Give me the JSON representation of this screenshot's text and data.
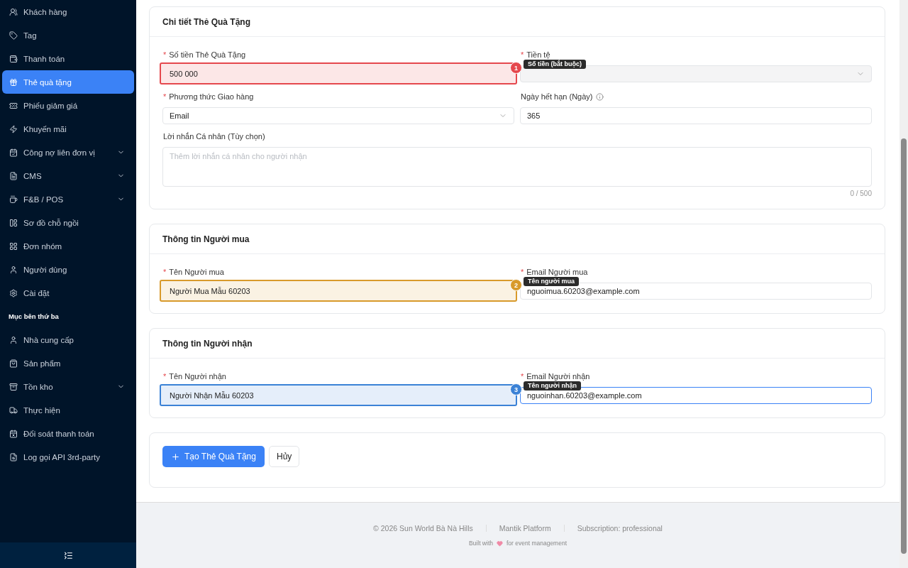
{
  "sidebar": {
    "items": [
      {
        "kind": "item",
        "label": "Khách hàng",
        "selected": false,
        "expandable": false
      },
      {
        "kind": "item",
        "label": "Tag",
        "selected": false,
        "expandable": false
      },
      {
        "kind": "item",
        "label": "Thanh toán",
        "selected": false,
        "expandable": false
      },
      {
        "kind": "item",
        "label": "Thẻ quà tặng",
        "selected": true,
        "expandable": false
      },
      {
        "kind": "item",
        "label": "Phiếu giảm giá",
        "selected": false,
        "expandable": false
      },
      {
        "kind": "item",
        "label": "Khuyến mãi",
        "selected": false,
        "expandable": false
      },
      {
        "kind": "item",
        "label": "Công nợ liên đơn vị",
        "selected": false,
        "expandable": true
      },
      {
        "kind": "item",
        "label": "CMS",
        "selected": false,
        "expandable": true
      },
      {
        "kind": "item",
        "label": "F&B / POS",
        "selected": false,
        "expandable": true
      },
      {
        "kind": "item",
        "label": "Sơ đồ chỗ ngồi",
        "selected": false,
        "expandable": false
      },
      {
        "kind": "item",
        "label": "Đơn nhóm",
        "selected": false,
        "expandable": false
      },
      {
        "kind": "item",
        "label": "Người dùng",
        "selected": false,
        "expandable": false
      },
      {
        "kind": "item",
        "label": "Cài đặt",
        "selected": false,
        "expandable": false
      },
      {
        "kind": "heading",
        "label": "Mục bên thứ ba"
      },
      {
        "kind": "item",
        "label": "Nhà cung cấp",
        "selected": false,
        "expandable": false
      },
      {
        "kind": "item",
        "label": "Sản phẩm",
        "selected": false,
        "expandable": false
      },
      {
        "kind": "item",
        "label": "Tồn kho",
        "selected": false,
        "expandable": true
      },
      {
        "kind": "item",
        "label": "Thực hiện",
        "selected": false,
        "expandable": false
      },
      {
        "kind": "item",
        "label": "Đối soát thanh toán",
        "selected": false,
        "expandable": false
      },
      {
        "kind": "item",
        "label": "Log gọi API 3rd-party",
        "selected": false,
        "expandable": false
      }
    ]
  },
  "sections": [
    {
      "title": "Chi tiết Thẻ Quà Tặng",
      "fields": [
        {
          "kind": "input",
          "label": "Số tiền Thẻ Quà Tặng",
          "required_mark": "*",
          "value": "500 000",
          "highlight": {
            "number": "1",
            "color": "#e5484d",
            "tooltip": "Số tiền (bắt buộc)"
          }
        },
        {
          "kind": "select",
          "label": "Tiền tệ",
          "required_mark": "*",
          "disabled": true
        },
        {
          "kind": "select",
          "label": "Phương thức Giao hàng",
          "required_mark": "*",
          "value": "Email"
        },
        {
          "kind": "input",
          "label": "Ngày hết hạn (Ngày)",
          "info": true,
          "value": "365"
        },
        {
          "kind": "textarea",
          "label": "Lời nhắn Cá nhân (Tùy chọn)",
          "placeholder": "Thêm lời nhắn cá nhân cho người nhận",
          "counter": "0 / 500"
        }
      ]
    },
    {
      "title": "Thông tin Người mua",
      "fields": [
        {
          "kind": "input",
          "label": "Tên Người mua",
          "required_mark": "*",
          "value": "Người Mua Mẫu 60203",
          "highlight": {
            "number": "2",
            "color": "#d89a2b",
            "tooltip": "Tên người mua"
          }
        },
        {
          "kind": "input",
          "label": "Email Người mua",
          "required_mark": "*",
          "value": "nguoimua.60203@example.com"
        }
      ]
    },
    {
      "title": "Thông tin Người nhận",
      "fields": [
        {
          "kind": "input",
          "label": "Tên Người nhận",
          "required_mark": "*",
          "value": "Người Nhận Mẫu 60203",
          "highlight": {
            "number": "3",
            "color": "#3b82d6",
            "tooltip": "Tên người nhận"
          }
        },
        {
          "kind": "input",
          "label": "Email Người nhận",
          "required_mark": "*",
          "focused": true,
          "value": "nguoinhan.60203@example.com"
        }
      ]
    }
  ],
  "actions": {
    "primary": "Tạo Thẻ Quà Tặng",
    "secondary": "Hủy"
  },
  "footer": {
    "links": [
      "© 2026 Sun World Bà Nà Hills",
      "Mantik Platform",
      "Subscription: professional"
    ],
    "built_with": "Built with",
    "built_for": "for event management"
  }
}
